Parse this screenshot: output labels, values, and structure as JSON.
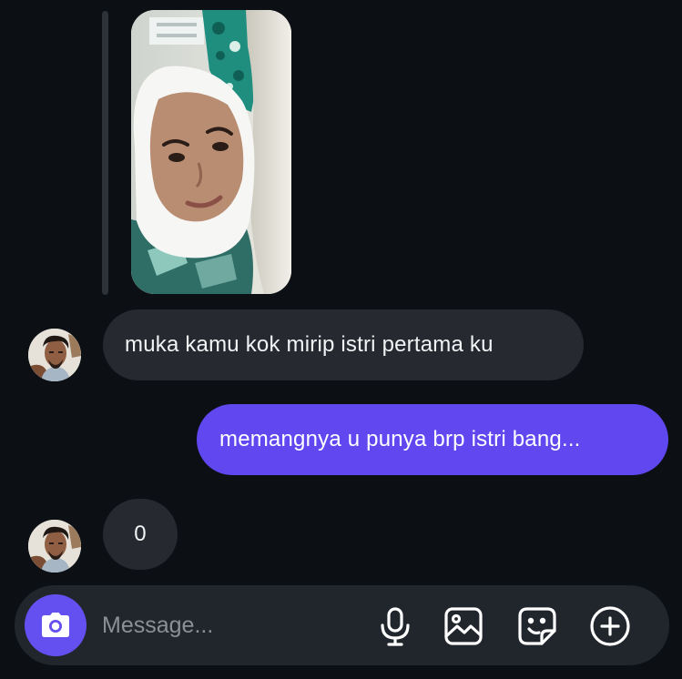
{
  "conversation": {
    "messages": [
      {
        "sender": "them",
        "type": "image"
      },
      {
        "sender": "them",
        "type": "text",
        "text": "muka kamu kok mirip istri pertama ku"
      },
      {
        "sender": "me",
        "type": "text",
        "text": "memangnya u punya brp istri bang..."
      },
      {
        "sender": "them",
        "type": "text",
        "text": "0"
      }
    ]
  },
  "composer": {
    "placeholder": "Message...",
    "icons": [
      "camera-icon",
      "microphone-icon",
      "gallery-icon",
      "sticker-icon",
      "plus-circle-icon"
    ]
  },
  "theme": {
    "background": "#0c1014",
    "incoming_bubble": "#262a30",
    "outgoing_bubble": "#6047f0",
    "accent": "#6450f0"
  }
}
